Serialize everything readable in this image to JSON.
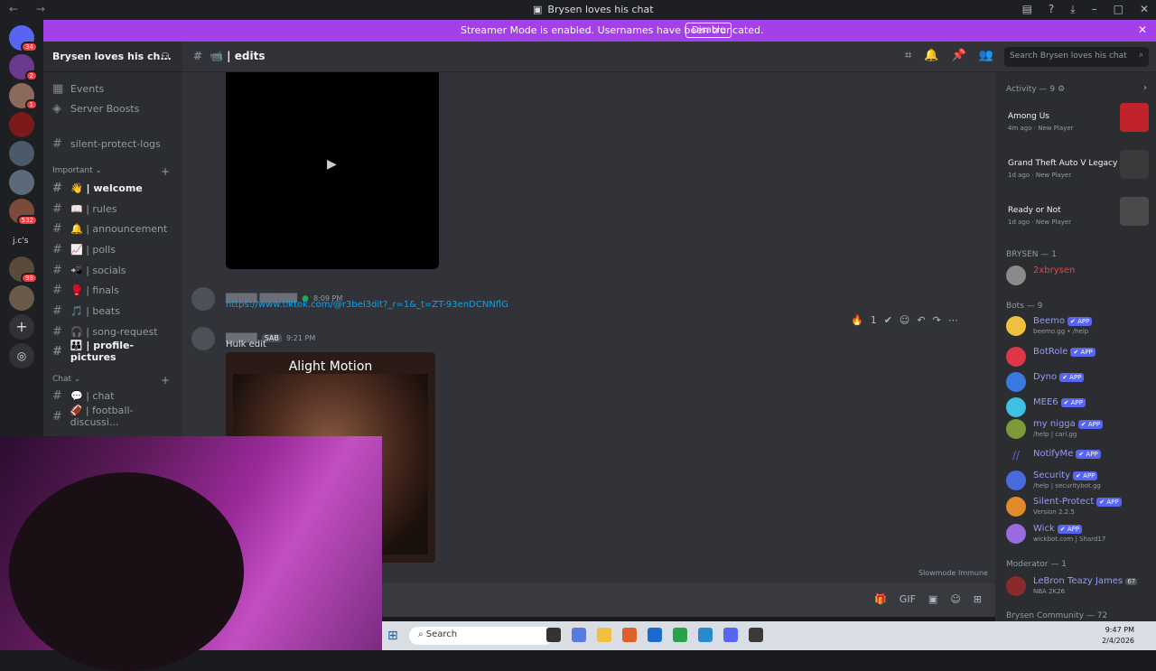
{
  "window": {
    "title": "Brysen loves his chat",
    "nav": "← →"
  },
  "banner": {
    "text": "Streamer Mode is enabled. Usernames have been truncated.",
    "button": "Disable"
  },
  "server": {
    "name": "Brysen loves his ch...",
    "rail_badges": [
      "34",
      "1",
      "532",
      "98",
      "2"
    ],
    "rail_label": "j.c's"
  },
  "sidebar": {
    "top_items": [
      "Events",
      "Server Boosts"
    ],
    "logs_channel": "silent-protect-logs",
    "categories": [
      "Important",
      "Chat"
    ],
    "important_channels": [
      "👋 | welcome",
      "📖 | rules",
      "🔔 | announcement",
      "📈 | polls",
      "📲 | socials",
      "🥊 | finals",
      "🎵 | beats",
      "🎧 | song-request",
      "👪 | profile-pictures"
    ],
    "chat_channels": [
      "💬 | chat",
      "🏈 | football-discussi..."
    ]
  },
  "header": {
    "channel": "📹 | edits",
    "search_placeholder": "Search Brysen loves his chat"
  },
  "messages": [
    {
      "time": "8:09 PM",
      "link": "https://www.tiktok.com/@r3bel3dit?_r=1&_t=ZT-93enDCNNflG"
    },
    {
      "tag": "SAB",
      "time": "9:21 PM",
      "text": "Hulk edit",
      "embed_caption": "Alight Motion"
    }
  ],
  "composer": {
    "slowmode": "Slowmode Immune"
  },
  "members": {
    "activity_header": "Activity — 9",
    "activities": [
      {
        "game": "Among Us",
        "ago": "4m ago",
        "tag": "New Player"
      },
      {
        "game": "Grand Theft Auto V Legacy",
        "ago": "1d ago",
        "tag": "New Player"
      },
      {
        "game": "Ready or Not",
        "ago": "1d ago",
        "tag": "New Player"
      }
    ],
    "brysen_header": "BRYSEN — 1",
    "brysen_member": "2xbrysen",
    "bots_header": "Bots — 9",
    "bots": [
      {
        "name": "Beemo",
        "sub": "beemo.gg • /help"
      },
      {
        "name": "BotRole",
        "sub": ""
      },
      {
        "name": "Dyno",
        "sub": ""
      },
      {
        "name": "MEE6",
        "sub": ""
      },
      {
        "name": "my nigga",
        "sub": "/help | carl.gg"
      },
      {
        "name": "NotifyMe",
        "sub": ""
      },
      {
        "name": "Security",
        "sub": "/help | securitybot.gg"
      },
      {
        "name": "Silent-Protect",
        "sub": "Version 2.2.5"
      },
      {
        "name": "Wick",
        "sub": "wickbot.com | Shard17"
      }
    ],
    "app_tag": "✔ APP",
    "moderator_header": "Moderator — 1",
    "moderator": {
      "name": "LeBron Teazy James",
      "badge": "67",
      "sub": "NBA 2K26"
    },
    "community_header": "Brysen Community — 72"
  },
  "taskbar": {
    "search": "Search",
    "time": "9:47 PM",
    "date": "2/4/2026"
  }
}
